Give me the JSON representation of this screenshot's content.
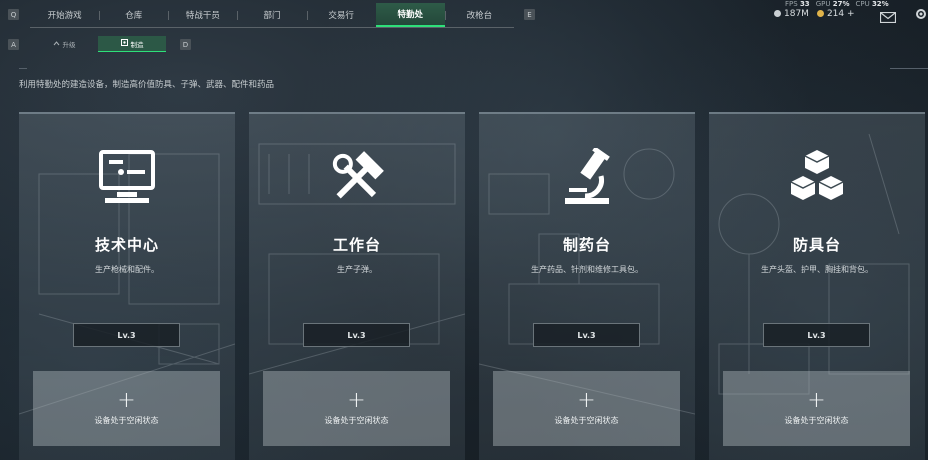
{
  "nav": {
    "left_key": "Q",
    "right_key": "E",
    "tabs": [
      {
        "label": "开始游戏",
        "active": false
      },
      {
        "label": "仓库",
        "active": false
      },
      {
        "label": "特战干员",
        "active": false
      },
      {
        "label": "部门",
        "active": false
      },
      {
        "label": "交易行",
        "active": false
      },
      {
        "label": "特勤处",
        "active": true
      },
      {
        "label": "改枪台",
        "active": false
      }
    ]
  },
  "stats": {
    "fps_label": "FPS",
    "fps_value": "33",
    "gpu_label": "GPU",
    "gpu_value": "27%",
    "cpu_label": "CPU",
    "cpu_value": "32%"
  },
  "currency": {
    "silver": "187M",
    "gold": "214",
    "add": "+",
    "silver_color": "#c9cfd3",
    "gold_color": "#e0b34a"
  },
  "subnav": {
    "left_key": "A",
    "right_key": "D",
    "tabs": [
      {
        "label": "升级",
        "icon": "upgrade-icon",
        "active": false
      },
      {
        "label": "制造",
        "icon": "craft-icon",
        "active": true
      }
    ]
  },
  "description": "利用特勤处的建造设备，制造高价值防具、子弹、武器、配件和药品",
  "cards": [
    {
      "title": "技术中心",
      "subtitle": "生产枪械和配件。",
      "level": "Lv.3",
      "icon": "computer-icon",
      "slot_text": "设备处于空闲状态"
    },
    {
      "title": "工作台",
      "subtitle": "生产子弹。",
      "level": "Lv.3",
      "icon": "hammer-wrench-icon",
      "slot_text": "设备处于空闲状态"
    },
    {
      "title": "制药台",
      "subtitle": "生产药品、针剂和维修工具包。",
      "level": "Lv.3",
      "icon": "microscope-icon",
      "slot_text": "设备处于空闲状态"
    },
    {
      "title": "防具台",
      "subtitle": "生产头盔、护甲、胸挂和背包。",
      "level": "Lv.3",
      "icon": "boxes-icon",
      "slot_text": "设备处于空闲状态"
    }
  ],
  "slot_plus": "+",
  "colors": {
    "accent": "#2ee07a",
    "active_tab_bg": "#2c5846"
  }
}
